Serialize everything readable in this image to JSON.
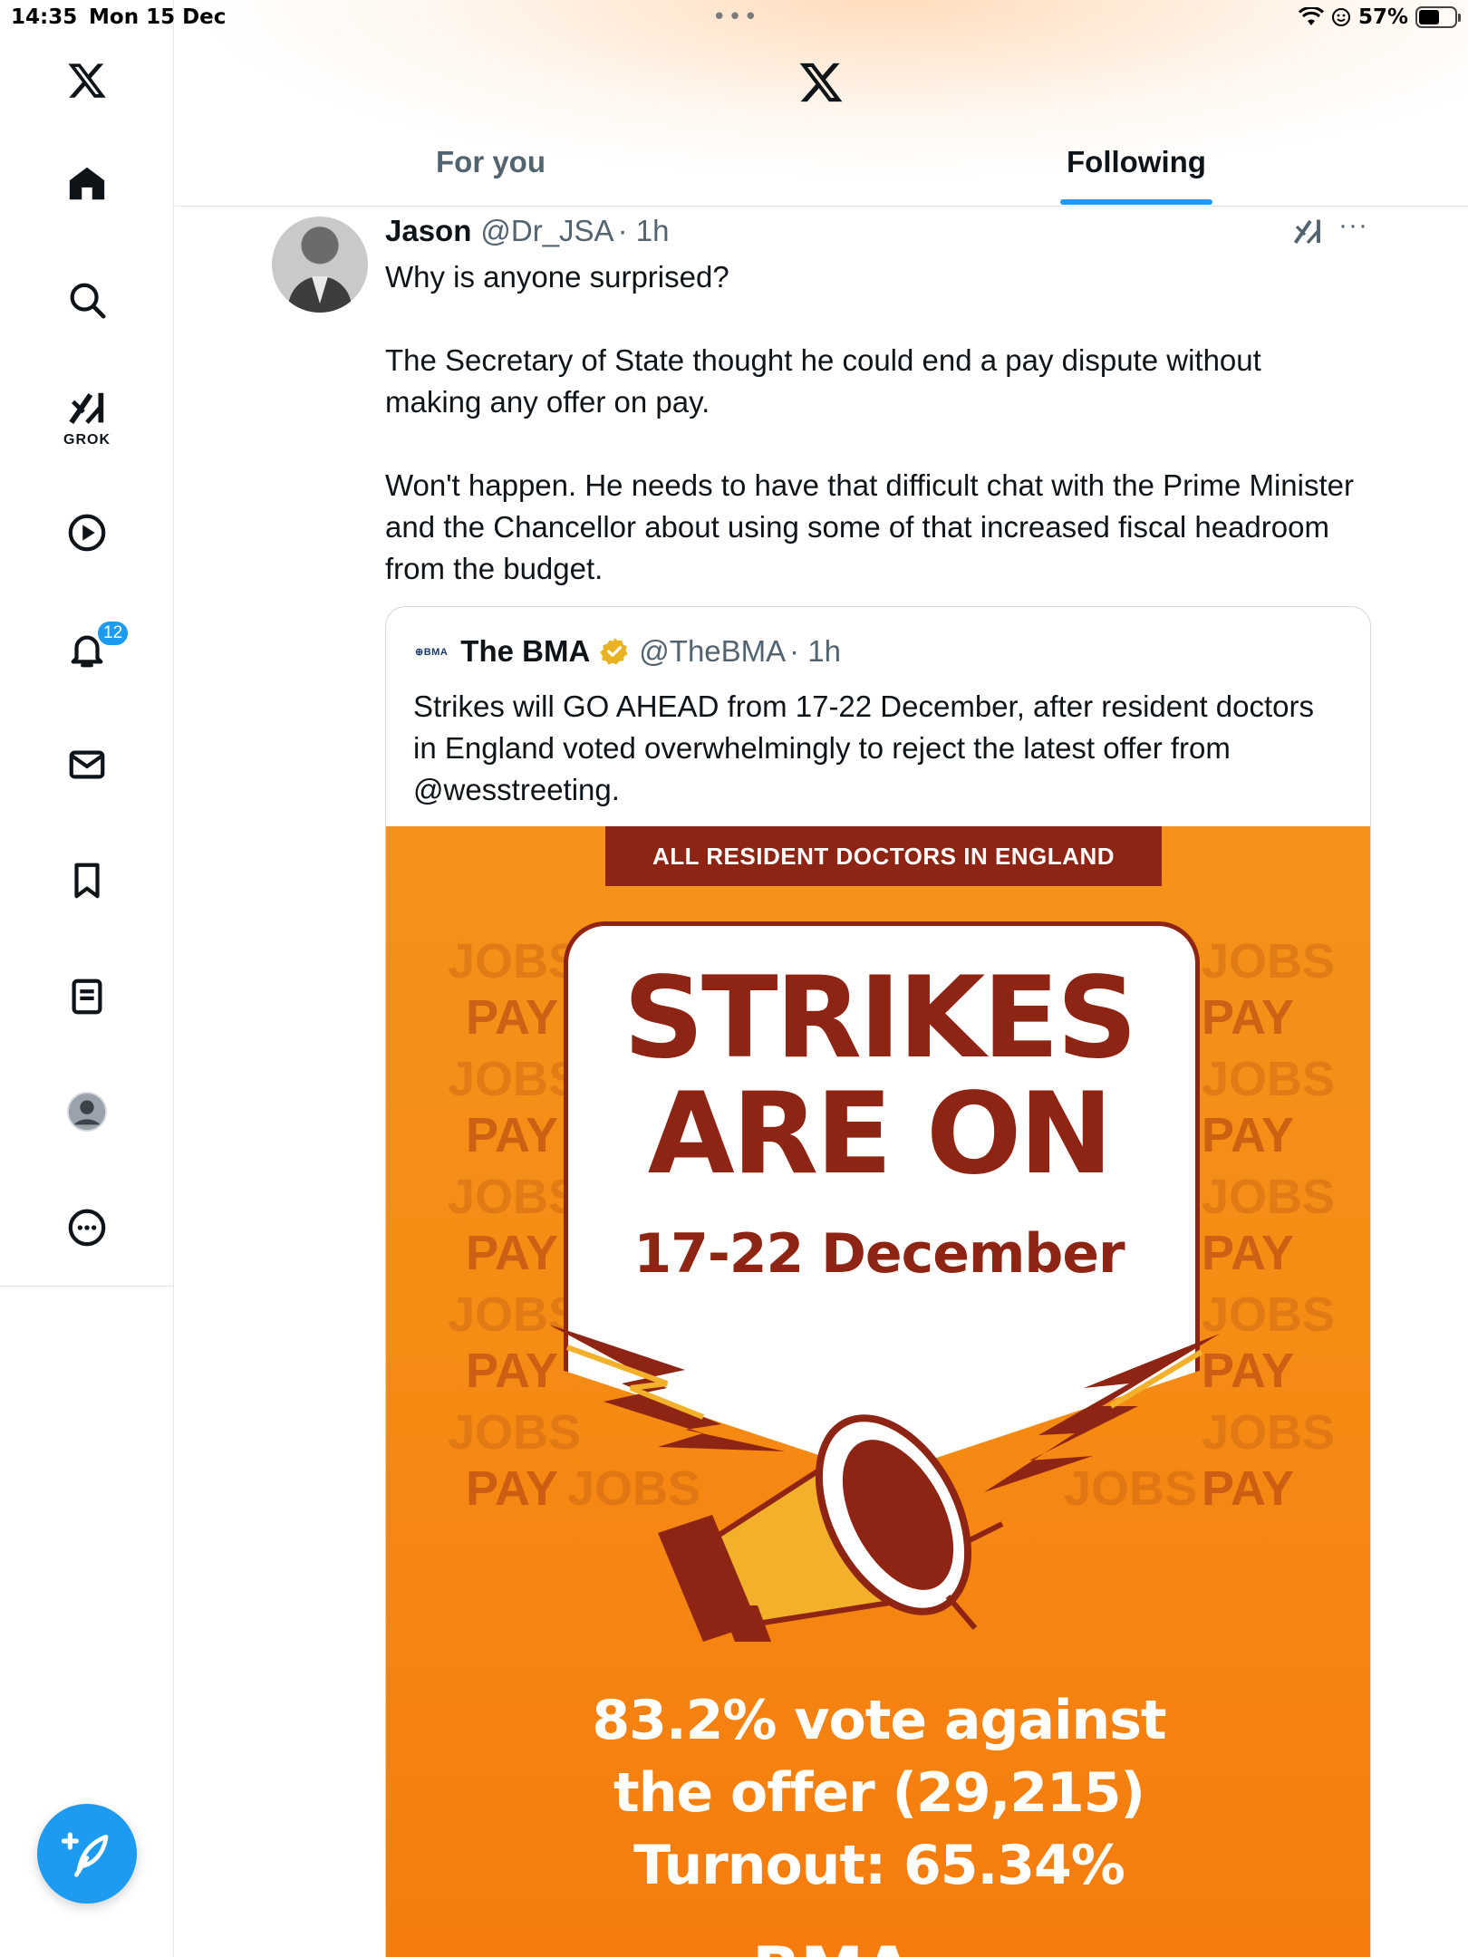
{
  "status_bar": {
    "time": "14:35",
    "date": "Mon 15 Dec",
    "battery": "57%",
    "battery_level": 0.57
  },
  "app": {
    "accent_color": "#1d9bf0"
  },
  "sidebar": {
    "items": [
      {
        "icon": "x-logo-icon"
      },
      {
        "icon": "home-icon"
      },
      {
        "icon": "search-icon"
      },
      {
        "icon": "grok-icon",
        "label": "GROK"
      },
      {
        "icon": "video-play-icon"
      },
      {
        "icon": "bell-icon",
        "badge": "12"
      },
      {
        "icon": "mail-icon"
      },
      {
        "icon": "bookmark-icon"
      },
      {
        "icon": "lists-icon"
      },
      {
        "icon": "profile-avatar-icon"
      },
      {
        "icon": "more-icon"
      }
    ],
    "compose_icon": "compose-plus-icon"
  },
  "header": {
    "tabs": [
      {
        "label": "For you",
        "active": false
      },
      {
        "label": "Following",
        "active": true
      }
    ]
  },
  "tweet": {
    "author_name": "Jason",
    "handle": "@Dr_JSA",
    "time": "· 1h",
    "body": "Why is anyone surprised?\n\nThe Secretary of State thought he could end a pay dispute without making any offer on pay.\n\nWon't happen. He needs to have that difficult chat with the Prime Minister and the Chancellor about using some of that increased fiscal headroom from the budget.",
    "more": "···"
  },
  "quote": {
    "logo_text": "⊕BMA",
    "author_name": "The BMA",
    "handle": "@TheBMA",
    "time": "· 1h",
    "body": "Strikes will GO AHEAD from 17-22 December, after resident doctors in England voted overwhelmingly to reject the latest offer from @wesstreeting.",
    "poster": {
      "banner": "ALL RESIDENT DOCTORS IN ENGLAND",
      "line1": "STRIKES",
      "line2": "ARE ON",
      "dates": "17-22 December",
      "stat1": "83.2% vote against",
      "stat2": "the offer (29,215)",
      "stat3": "Turnout: 65.34%",
      "bg_word_jobs": "JOBS",
      "bg_word_pay": "PAY",
      "footer": "BMA",
      "colors": {
        "orange": "#f58c14",
        "maroon": "#8e2413",
        "gold": "#f3b12b"
      }
    }
  }
}
